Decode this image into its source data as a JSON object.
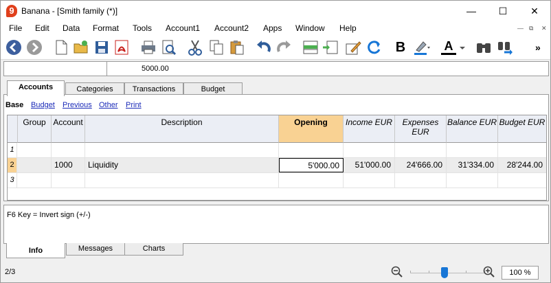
{
  "window": {
    "title": "Banana - [Smith family (*)]",
    "logo": "9",
    "minimize": "—",
    "maximize": "☐",
    "close": "✕"
  },
  "menu": [
    "File",
    "Edit",
    "Data",
    "Format",
    "Tools",
    "Account1",
    "Account2",
    "Apps",
    "Window",
    "Help"
  ],
  "mdi": {
    "min": "—",
    "restore": "⧉",
    "close": "✕"
  },
  "toolbar": {
    "icons": [
      "back-icon",
      "forward-icon",
      "new-file-icon",
      "open-folder-icon",
      "save-icon",
      "pdf-icon",
      "print-icon",
      "print-preview-icon",
      "cut-icon",
      "copy-icon",
      "paste-icon",
      "undo-icon",
      "redo-icon",
      "add-rows-icon",
      "insert-rows-icon",
      "edit-pencil-icon",
      "recheck-icon",
      "bold-icon",
      "highlight-color-icon",
      "text-color-icon",
      "find-icon",
      "find-replace-icon"
    ],
    "bold_label": "B",
    "text_color_label": "A",
    "more": "»"
  },
  "cell_editor": {
    "value": "5000.00"
  },
  "tables": [
    "Accounts",
    "Categories",
    "Transactions",
    "Budget"
  ],
  "views": [
    "Base",
    "Budget",
    "Previous",
    "Other",
    "Print"
  ],
  "columns": [
    "Group",
    "Account",
    "Description",
    "Opening",
    "Income EUR",
    "Expenses EUR",
    "Balance EUR",
    "Budget EUR"
  ],
  "rows": [
    {
      "n": "1",
      "group": "",
      "account": "",
      "description": "",
      "opening": "",
      "income": "",
      "expenses": "",
      "balance": "",
      "budget": ""
    },
    {
      "n": "2",
      "group": "",
      "account": "1000",
      "description": "Liquidity",
      "opening": "5'000.00",
      "income": "51'000.00",
      "expenses": "24'666.00",
      "balance": "31'334.00",
      "budget": "28'244.00"
    },
    {
      "n": "3",
      "group": "",
      "account": "",
      "description": "",
      "opening": "",
      "income": "",
      "expenses": "",
      "balance": "",
      "budget": ""
    }
  ],
  "info": {
    "message": "F6 Key = Invert sign (+/-)"
  },
  "bottom_tabs": [
    "Info",
    "Messages",
    "Charts"
  ],
  "status": {
    "position": "2/3",
    "zoom": "100 %",
    "zoom_level": 0.45
  },
  "colors": {
    "accent": "#f9d293",
    "header_bg": "#ebeef5",
    "link": "#1a2ab8",
    "logo": "#e0401c",
    "slider": "#1776d6"
  }
}
